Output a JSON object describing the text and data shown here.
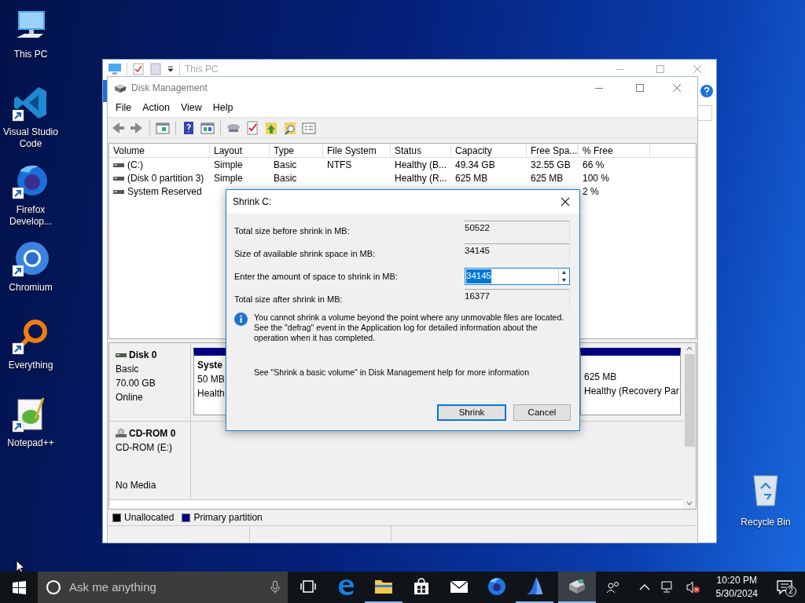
{
  "desktop_icons": [
    {
      "label": "This PC",
      "kind": "pc",
      "shortcut": false
    },
    {
      "label": "Visual Studio Code",
      "kind": "vscode",
      "shortcut": true
    },
    {
      "label": "Firefox Develop...",
      "kind": "firefox",
      "shortcut": true
    },
    {
      "label": "Chromium",
      "kind": "chromium",
      "shortcut": true
    },
    {
      "label": "Everything",
      "kind": "everything",
      "shortcut": true
    },
    {
      "label": "Notepad++",
      "kind": "notepad",
      "shortcut": true
    }
  ],
  "recycle_bin": {
    "label": "Recycle Bin"
  },
  "explorer_window": {
    "title": "This PC",
    "active": false
  },
  "disk_management": {
    "title": "Disk Management",
    "active": false,
    "menu": [
      "File",
      "Action",
      "View",
      "Help"
    ],
    "columns": [
      "Volume",
      "Layout",
      "Type",
      "File System",
      "Status",
      "Capacity",
      "Free Spa...",
      "% Free"
    ],
    "rows": [
      {
        "cells": [
          "(C:)",
          "Simple",
          "Basic",
          "NTFS",
          "Healthy (B...",
          "49.34 GB",
          "32.55 GB",
          "66 %"
        ]
      },
      {
        "cells": [
          "(Disk 0 partition 3)",
          "Simple",
          "Basic",
          null,
          "Healthy (R...",
          "625 MB",
          "625 MB",
          "100 %"
        ]
      },
      {
        "cells": [
          "System Reserved",
          null,
          null,
          null,
          null,
          null,
          null,
          "2 %"
        ]
      }
    ],
    "disks": [
      {
        "kind": "disk",
        "name": "Disk 0",
        "type_line": "Basic",
        "size": "70.00 GB",
        "status": "Online",
        "partitions": [
          {
            "name": "Syste",
            "size": "50 MB",
            "status": "Health"
          },
          {
            "size": "625 MB",
            "status": "Healthy (Recovery Par"
          }
        ]
      },
      {
        "kind": "cdrom",
        "name": "CD-ROM 0",
        "type_line": "CD-ROM (E:)",
        "status": "No Media"
      }
    ],
    "legend": [
      {
        "label": "Unallocated",
        "color": "#000000"
      },
      {
        "label": "Primary partition",
        "color": "#000080"
      }
    ]
  },
  "dialog": {
    "title": "Shrink C:",
    "fields": [
      {
        "kind": "readonly",
        "label": "Total size before shrink in MB:",
        "value": "50522"
      },
      {
        "kind": "readonly",
        "label": "Size of available shrink space in MB:",
        "value": "34145"
      },
      {
        "kind": "spin",
        "label": "Enter the amount of space to shrink in MB:",
        "value": "34145",
        "text_selected": true
      },
      {
        "kind": "readonly",
        "label": "Total size after shrink in MB:",
        "value": "16377"
      }
    ],
    "info": "You cannot shrink a volume beyond the point where any unmovable files are located. See the \"defrag\" event in the Application log for detailed information about the operation when it has completed.",
    "help": "See \"Shrink a basic volume\" in Disk Management help for more information",
    "buttons": [
      {
        "label": "Shrink",
        "default": true
      },
      {
        "label": "Cancel",
        "default": false
      }
    ]
  },
  "taskbar": {
    "search": {
      "placeholder": "Ask me anything"
    },
    "apps": [
      {
        "kind": "taskview",
        "running": false,
        "selected": false
      },
      {
        "kind": "edge",
        "running": false,
        "selected": false
      },
      {
        "kind": "explorer",
        "running": true,
        "selected": false
      },
      {
        "kind": "store",
        "running": false,
        "selected": false
      },
      {
        "kind": "mail",
        "running": false,
        "selected": false
      },
      {
        "kind": "firefox",
        "running": false,
        "selected": false
      },
      {
        "kind": "bluebird",
        "running": true,
        "selected": false
      },
      {
        "kind": "diskmgmt",
        "running": true,
        "selected": true
      }
    ],
    "clock": {
      "time": "10:20 PM",
      "date": "5/30/2024"
    },
    "notifications": "2"
  }
}
